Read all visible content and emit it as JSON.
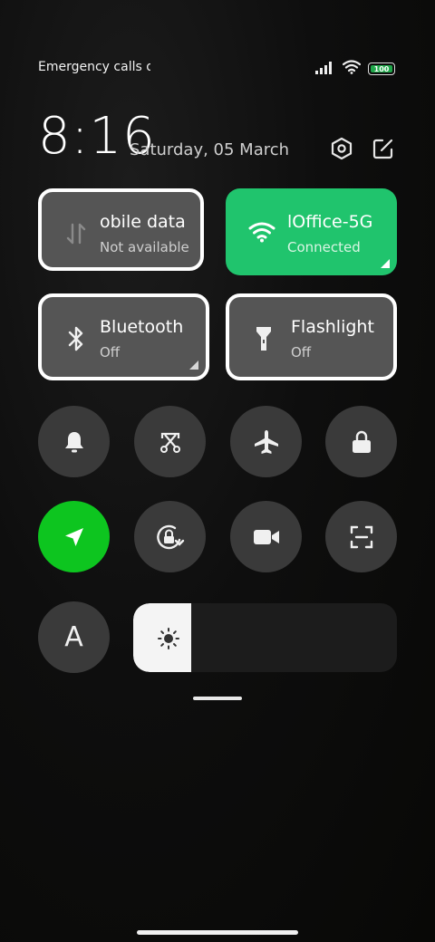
{
  "status_bar": {
    "carrier_text": "Emergency calls only",
    "battery_level": "100",
    "icons": [
      "signal-icon",
      "wifi-icon",
      "battery-icon"
    ]
  },
  "header": {
    "time": "8:16",
    "date": "Saturday, 05 March",
    "settings_icon": "settings-hexagon-icon",
    "edit_icon": "edit-icon"
  },
  "tiles": [
    {
      "id": "mobile-data",
      "title": "obile data",
      "subtitle": "Not available",
      "state": "off",
      "icon": "mobile-data-arrows-icon"
    },
    {
      "id": "wifi",
      "title": "lOffice-5G",
      "subtitle": "Connected",
      "state": "on",
      "icon": "wifi-icon"
    },
    {
      "id": "bluetooth",
      "title": "Bluetooth",
      "subtitle": "Off",
      "state": "off",
      "icon": "bluetooth-icon"
    },
    {
      "id": "flashlight",
      "title": "Flashlight",
      "subtitle": "Off",
      "state": "off",
      "icon": "flashlight-icon"
    }
  ],
  "toggles_row1": [
    "bell-icon",
    "screenshot-icon",
    "airplane-icon",
    "lock-icon"
  ],
  "toggles_row2": [
    "location-icon",
    "rotation-lock-icon",
    "video-camera-icon",
    "scan-icon"
  ],
  "font_toggle_label": "A",
  "brightness": {
    "level": 0.22,
    "icon": "sun-icon"
  },
  "colors": {
    "accent_green": "#20c46d",
    "location_green": "#0dc51f",
    "tile_off": "#555555",
    "round_btn": "#3a3a3a"
  }
}
